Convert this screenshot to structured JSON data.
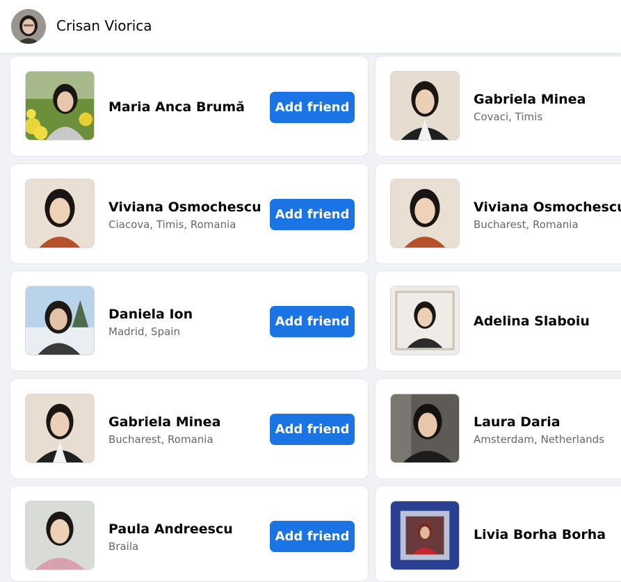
{
  "header": {
    "user_name": "Crisan Viorica"
  },
  "left": [
    {
      "name": "Maria Anca Brumă",
      "location": "",
      "button": "Add friend"
    },
    {
      "name": "Viviana Osmochescu",
      "location": "Ciacova, Timis, Romania",
      "button": "Add friend"
    },
    {
      "name": "Daniela Ion",
      "location": "Madrid, Spain",
      "button": "Add friend"
    },
    {
      "name": "Gabriela Minea",
      "location": "Bucharest, Romania",
      "button": "Add friend"
    },
    {
      "name": "Paula Andreescu",
      "location": "Braila",
      "button": "Add friend"
    }
  ],
  "right": [
    {
      "name": "Gabriela Minea",
      "location": "Covaci, Timis"
    },
    {
      "name": "Viviana Osmochescu",
      "location": "Bucharest, Romania"
    },
    {
      "name": "Adelina Slaboiu",
      "location": ""
    },
    {
      "name": "Laura Daria",
      "location": "Amsterdam, Netherlands"
    },
    {
      "name": "Livia Borha Borha",
      "location": ""
    }
  ]
}
